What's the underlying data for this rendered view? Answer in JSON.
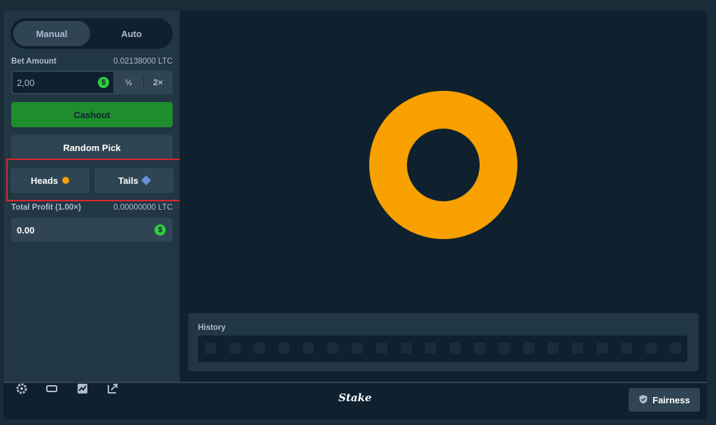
{
  "mode_tabs": {
    "manual": "Manual",
    "auto": "Auto"
  },
  "bet": {
    "label": "Bet Amount",
    "amount_ltc": "0.02138000 LTC",
    "value": "2,00",
    "half": "½",
    "double": "2×"
  },
  "actions": {
    "cashout": "Cashout",
    "random_pick": "Random Pick"
  },
  "choices": {
    "heads": "Heads",
    "tails": "Tails"
  },
  "profit": {
    "label": "Total Profit (1.00×)",
    "amount_ltc": "0.00000000 LTC",
    "value": "0.00"
  },
  "currency_symbol": "$",
  "history": {
    "title": "History"
  },
  "bottombar": {
    "brand": "Stake",
    "fairness": "Fairness"
  },
  "colors": {
    "coin": "#f7a000",
    "accent_green": "#1f8c2e",
    "panel": "#213743",
    "bg": "#0f212e"
  }
}
